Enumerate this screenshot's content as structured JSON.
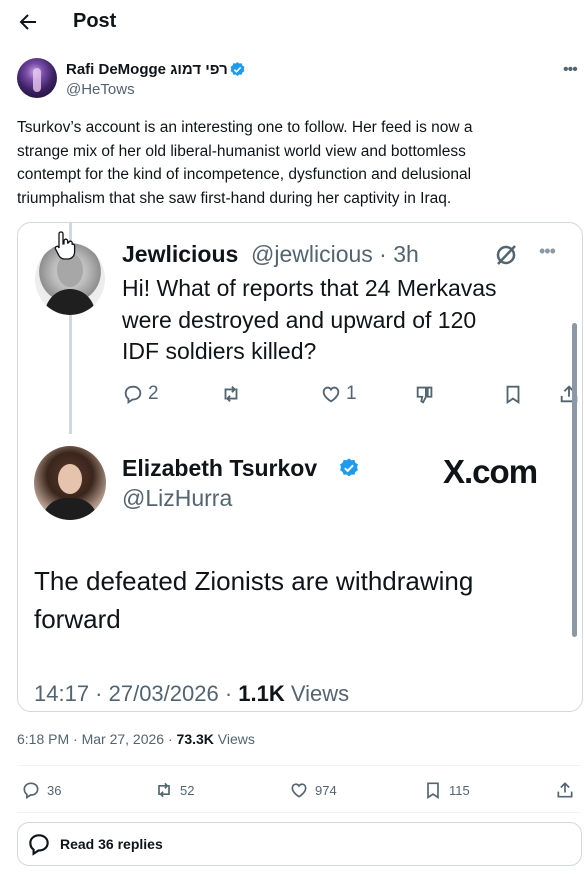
{
  "header": {
    "title": "Post"
  },
  "author": {
    "name": "Rafi DeMogge רפי דמוג",
    "handle": "@HeTows"
  },
  "tweet": {
    "line1": "Tsurkov’s account is an interesting one to follow. Her feed is now a",
    "line2": "strange mix of her old liberal-humanist world view and bottomless",
    "line3": "contempt for the kind of incompetence, dysfunction and delusional",
    "line4": "triumphalism that she saw first-hand during her captivity in Iraq."
  },
  "quote": {
    "reply": {
      "name": "Jewlicious",
      "handle_time": "@jewlicious · 3h",
      "line1": "Hi! What of reports that 24 Merkavas",
      "line2": "were destroyed and upward of 120",
      "line3": "IDF soldiers killed?",
      "replies": "2",
      "likes": "1"
    },
    "original": {
      "name": "Elizabeth Tsurkov",
      "handle": "@LizHurra",
      "brand": "X.com",
      "line1": "The defeated Zionists are withdrawing",
      "line2": "forward",
      "time": "14:17 · 27/03/2026 · ",
      "views_count": "1.1K",
      "views_label": " Views"
    }
  },
  "meta": {
    "time": "6:18 PM · Mar 27, 2026 · ",
    "views_count": "73.3K",
    "views_label": " Views"
  },
  "stats": {
    "replies": "36",
    "reposts": "52",
    "likes": "974",
    "bookmarks": "115"
  },
  "read_replies": "Read 36 replies",
  "colors": {
    "text": "#0f1419",
    "secondary": "#536471",
    "verified": "#1d9bf0",
    "border": "#cfd9de"
  }
}
